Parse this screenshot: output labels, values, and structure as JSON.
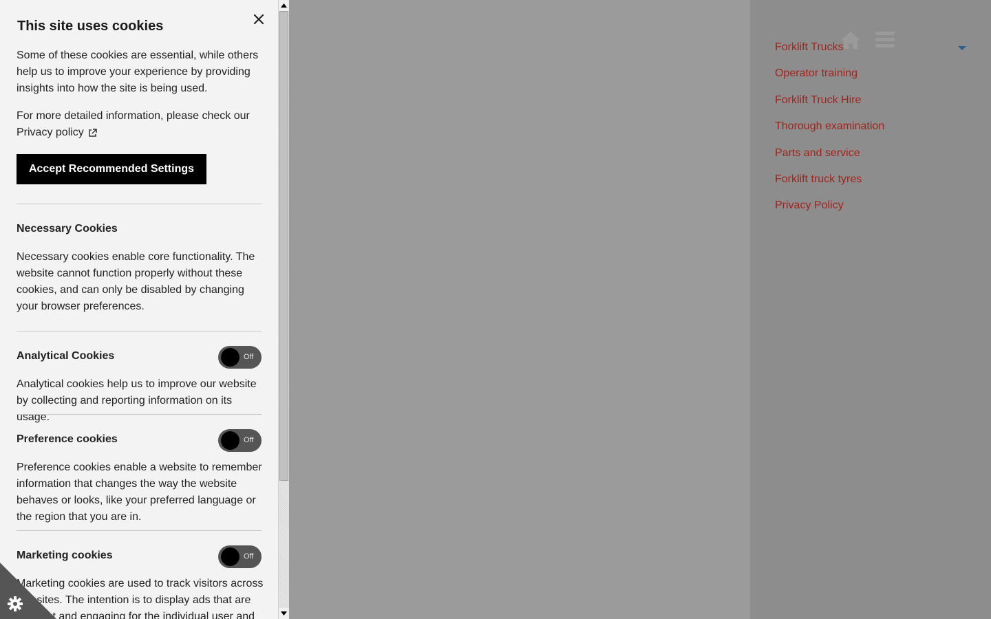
{
  "cookie_panel": {
    "title": "This site uses cookies",
    "intro": "Some of these cookies are essential, while others help us to improve your experience by providing insights into how the site is being used.",
    "more_info_prefix": "For more detailed information, please check our",
    "privacy_link": "Privacy policy",
    "accept_button": "Accept Recommended Settings",
    "sections": [
      {
        "title": "Necessary Cookies",
        "description": "Necessary cookies enable core functionality. The website cannot function properly without these cookies, and can only be disabled by changing your browser preferences."
      },
      {
        "title": "Analytical Cookies",
        "toggle": "Off",
        "description": "Analytical cookies help us to improve our website by collecting and reporting information on its usage."
      },
      {
        "title": "Preference cookies",
        "toggle": "Off",
        "description": "Preference cookies enable a website to remember information that changes the way the website behaves or looks, like your preferred language or the region that you are in."
      },
      {
        "title": "Marketing cookies",
        "toggle": "Off",
        "description": "Marketing cookies are used to track visitors across websites. The intention is to display ads that are relevant and engaging for the individual user and"
      }
    ]
  },
  "sidebar_nav": {
    "items": [
      "Forklift Trucks",
      "Operator training",
      "Forklift Truck Hire",
      "Thorough examination",
      "Parts and service",
      "Forklift truck tyres",
      "Privacy Policy"
    ]
  },
  "icons": {
    "close": "close-icon",
    "external": "external-link-icon",
    "settings": "gear-icon",
    "home": "home-icon",
    "menu": "menu-icon",
    "caret": "caret-down-icon"
  },
  "colors": {
    "link": "#a2231d",
    "panel_bg": "#f3f3f3",
    "accept_bg": "#000000",
    "overlay": "#9b9b9b"
  }
}
